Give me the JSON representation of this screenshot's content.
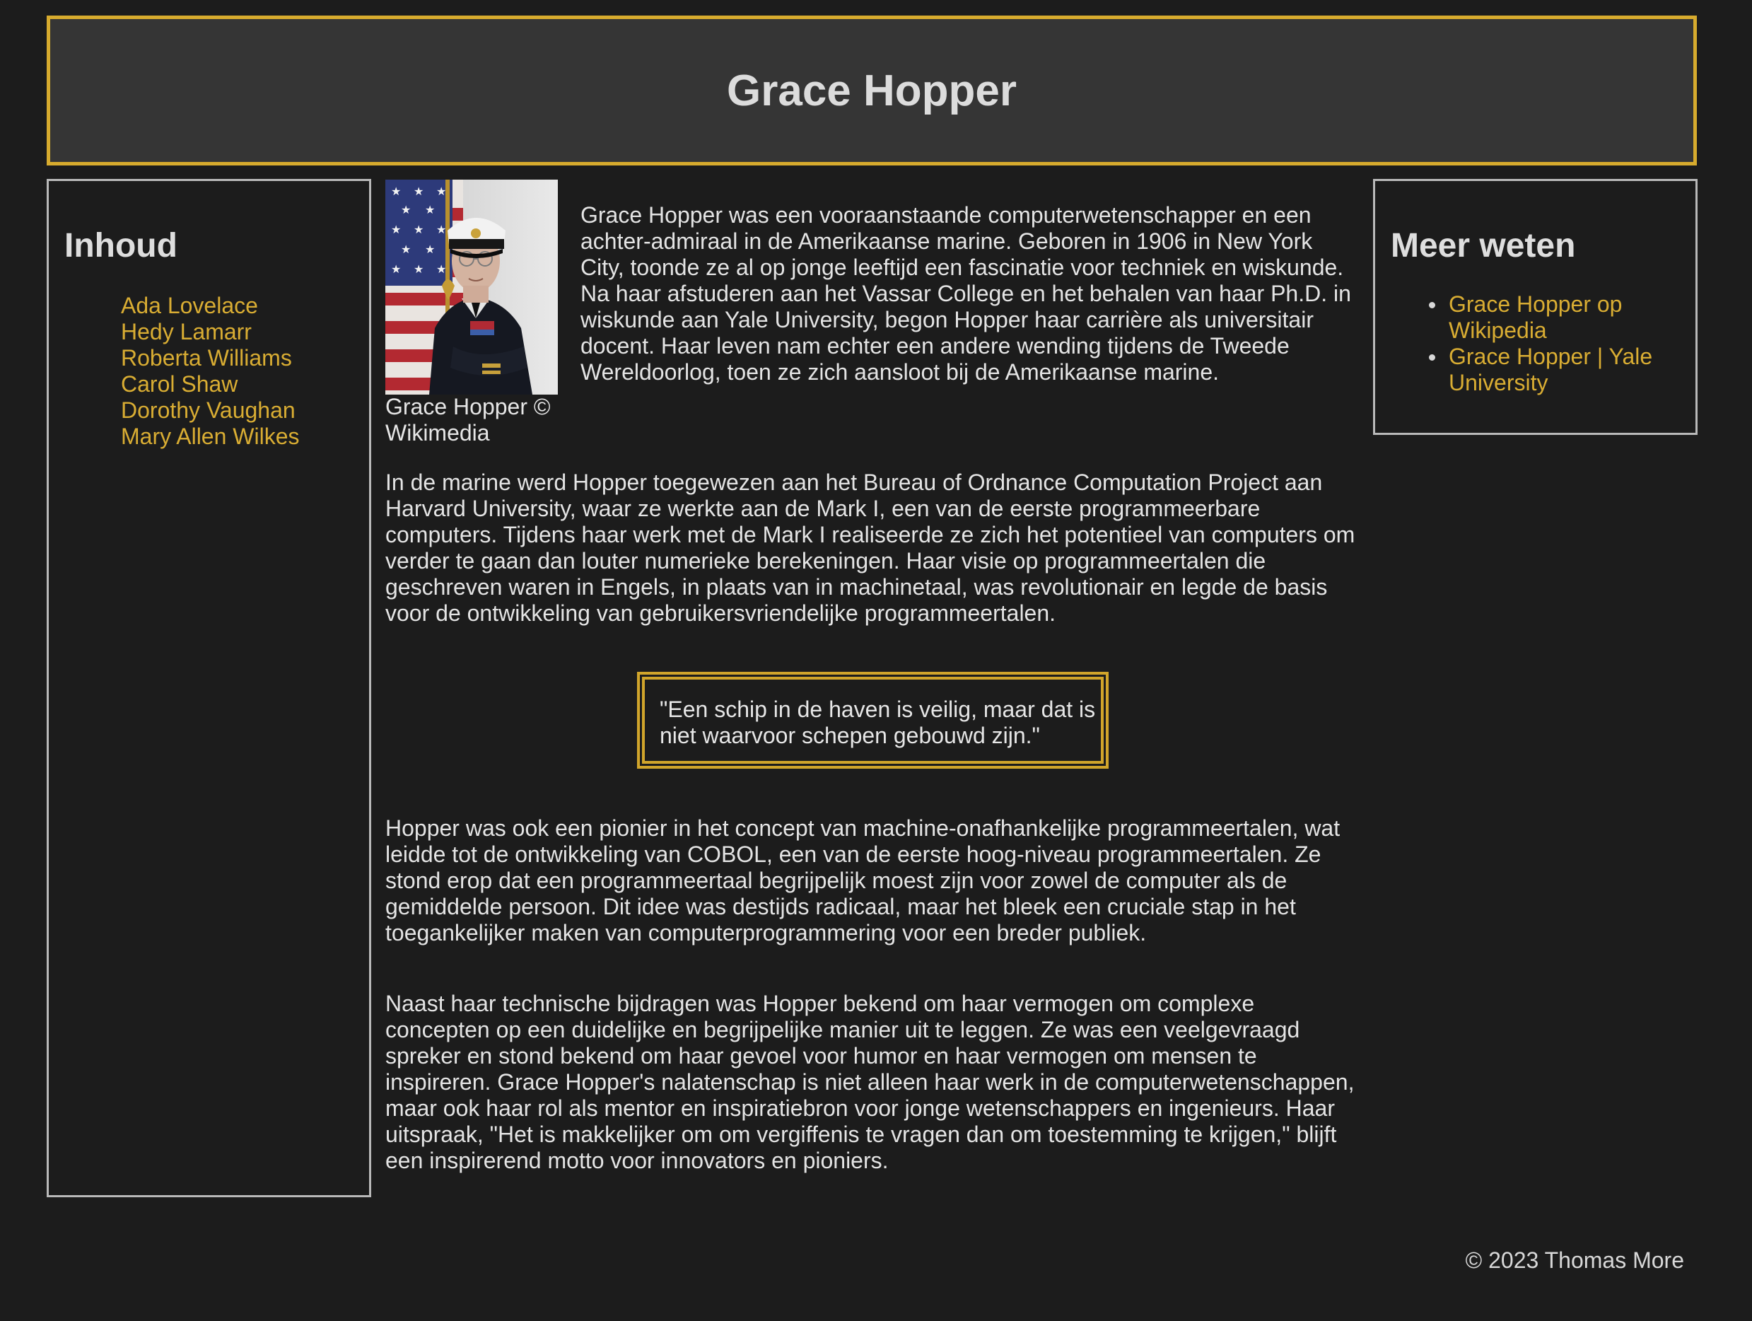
{
  "header": {
    "title": "Grace Hopper"
  },
  "sidebar_left": {
    "heading": "Inhoud",
    "links": [
      "Ada Lovelace",
      "Hedy Lamarr",
      "Roberta Williams",
      "Carol Shaw",
      "Dorothy Vaughan",
      "Mary Allen Wilkes"
    ]
  },
  "sidebar_right": {
    "heading": "Meer weten",
    "links": [
      "Grace Hopper op Wikipedia",
      "Grace Hopper | Yale University"
    ]
  },
  "main": {
    "caption": "Grace Hopper © Wikimedia",
    "paragraphs": [
      "Grace Hopper was een vooraanstaande computerwetenschapper en een achter-admiraal in de Amerikaanse marine. Geboren in 1906 in New York City, toonde ze al op jonge leeftijd een fascinatie voor techniek en wiskunde. Na haar afstuderen aan het Vassar College en het behalen van haar Ph.D. in wiskunde aan Yale University, begon Hopper haar carrière als universitair docent. Haar leven nam echter een andere wending tijdens de Tweede Wereldoorlog, toen ze zich aansloot bij de Amerikaanse marine.",
      "In de marine werd Hopper toegewezen aan het Bureau of Ordnance Computation Project aan Harvard University, waar ze werkte aan de Mark I, een van de eerste programmeerbare computers. Tijdens haar werk met de Mark I realiseerde ze zich het potentieel van computers om verder te gaan dan louter numerieke berekeningen. Haar visie op programmeertalen die geschreven waren in Engels, in plaats van in machinetaal, was revolutionair en legde de basis voor de ontwikkeling van gebruikersvriendelijke programmeertalen.",
      "Hopper was ook een pionier in het concept van machine-onafhankelijke programmeertalen, wat leidde tot de ontwikkeling van COBOL, een van de eerste hoog-niveau programmeertalen. Ze stond erop dat een programmeertaal begrijpelijk moest zijn voor zowel de computer als de gemiddelde persoon. Dit idee was destijds radicaal, maar het bleek een cruciale stap in het toegankelijker maken van computerprogrammering voor een breder publiek.",
      "Naast haar technische bijdragen was Hopper bekend om haar vermogen om complexe concepten op een duidelijke en begrijpelijke manier uit te leggen. Ze was een veelgevraagd spreker en stond bekend om haar gevoel voor humor en haar vermogen om mensen te inspireren. Grace Hopper's nalatenschap is niet alleen haar werk in de computerwetenschappen, maar ook haar rol als mentor en inspiratiebron voor jonge wetenschappers en ingenieurs. Haar uitspraak, \"Het is makkelijker om om vergiffenis te vragen dan om toestemming te krijgen,\" blijft een inspirerend motto voor innovators en pioniers."
    ],
    "quote": "\"Een schip in de haven is veilig, maar dat is niet waarvoor schepen gebouwd zijn.\""
  },
  "footer": {
    "text": "© 2023 Thomas More"
  },
  "colors": {
    "background": "#1c1c1c",
    "header_background": "#353535",
    "accent": "#d7ab2e",
    "sidebar_border": "#b9b9b9",
    "text": "#e4e4e4"
  }
}
